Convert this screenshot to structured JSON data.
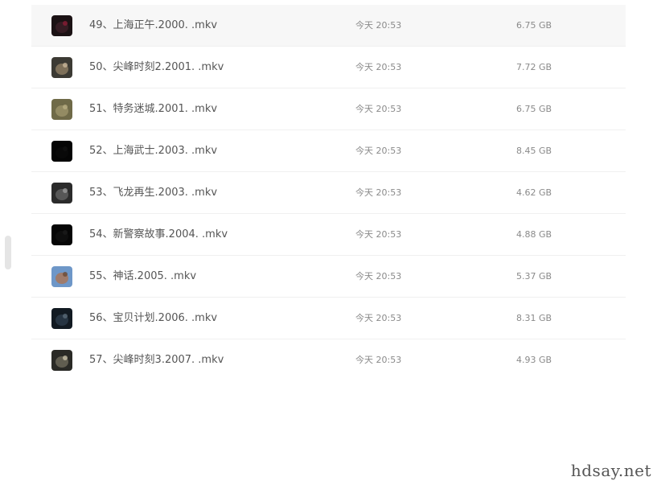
{
  "files": [
    {
      "name": "49、上海正午.2000. .mkv",
      "date": "今天 20:53",
      "size": "6.75 GB",
      "thumb_colors": [
        "#1b1214",
        "#3a1e26",
        "#8a1d34"
      ]
    },
    {
      "name": "50、尖峰时刻2.2001. .mkv",
      "date": "今天 20:53",
      "size": "7.72 GB",
      "thumb_colors": [
        "#3c3a34",
        "#8a7a62",
        "#c9b79a"
      ]
    },
    {
      "name": "51、特务迷城.2001. .mkv",
      "date": "今天 20:53",
      "size": "6.75 GB",
      "thumb_colors": [
        "#6f6a48",
        "#9a9168",
        "#b9ae82"
      ]
    },
    {
      "name": "52、上海武士.2003. .mkv",
      "date": "今天 20:53",
      "size": "8.45 GB",
      "thumb_colors": [
        "#050505",
        "#0b0b0b",
        "#121212"
      ]
    },
    {
      "name": "53、飞龙再生.2003. .mkv",
      "date": "今天 20:53",
      "size": "4.62 GB",
      "thumb_colors": [
        "#2b2b2b",
        "#5f5f5f",
        "#9a9a9a"
      ]
    },
    {
      "name": "54、新警察故事.2004. .mkv",
      "date": "今天 20:53",
      "size": "4.88 GB",
      "thumb_colors": [
        "#060606",
        "#111111",
        "#1c1c1c"
      ]
    },
    {
      "name": "55、神话.2005. .mkv",
      "date": "今天 20:53",
      "size": "5.37 GB",
      "thumb_colors": [
        "#6e97c8",
        "#a8765a",
        "#6a4a34"
      ]
    },
    {
      "name": "56、宝贝计划.2006. .mkv",
      "date": "今天 20:53",
      "size": "8.31 GB",
      "thumb_colors": [
        "#121a22",
        "#2a3a48",
        "#5a6a78"
      ]
    },
    {
      "name": "57、尖峰时刻3.2007. .mkv",
      "date": "今天 20:53",
      "size": "4.93 GB",
      "thumb_colors": [
        "#2a2a26",
        "#6a6658",
        "#c8c0a8"
      ]
    }
  ],
  "highlighted_row": 0,
  "watermark": "hdsay.net"
}
